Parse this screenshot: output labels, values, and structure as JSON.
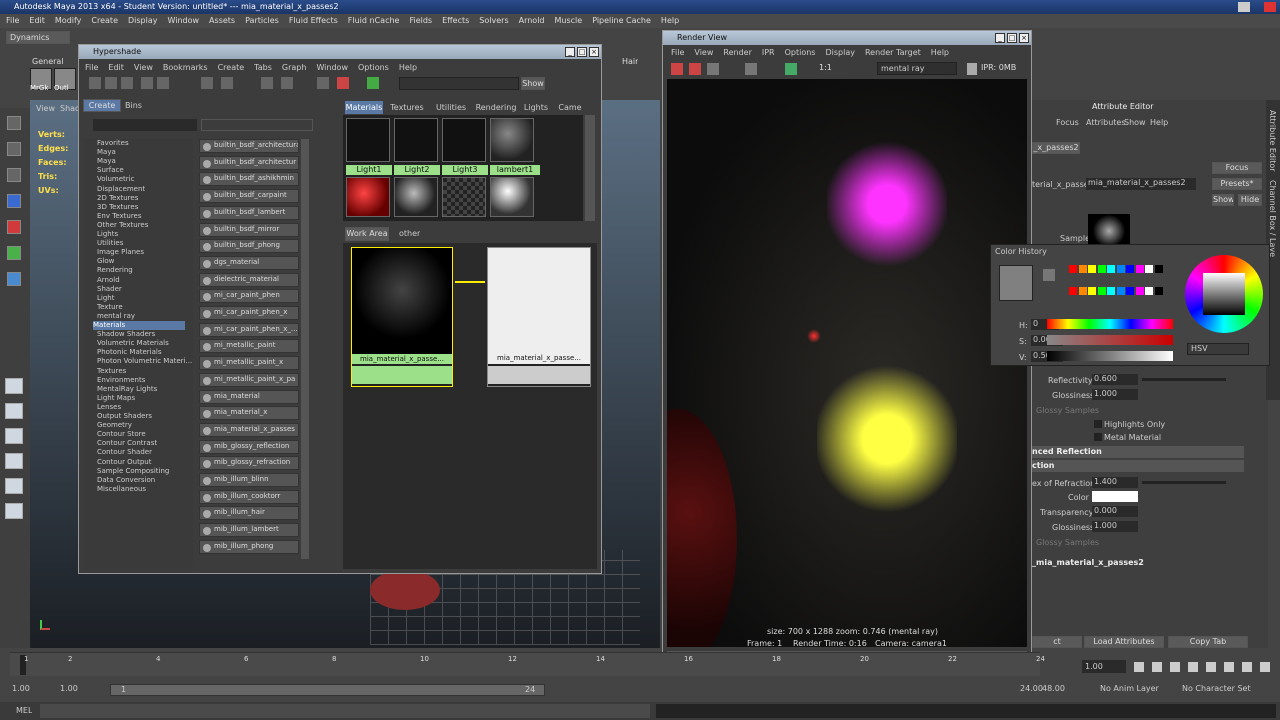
{
  "app": {
    "title": "Autodesk Maya 2013 x64 - Student Version: untitled*  ---  mia_material_x_passes2",
    "menus": [
      "File",
      "Edit",
      "Modify",
      "Create",
      "Display",
      "Window",
      "Assets",
      "Particles",
      "Fluid Effects",
      "Fluid nCache",
      "Fields",
      "Effects",
      "Solvers",
      "Arnold",
      "Muscle",
      "Pipeline Cache",
      "Help"
    ],
    "mode": "Dynamics",
    "shelf_tabs": [
      "General",
      "Hair"
    ],
    "shelf_labels": [
      "MrGk",
      "Outl"
    ]
  },
  "left_panel": {
    "menus": [
      "View",
      "Shad"
    ],
    "hud": [
      "Verts:",
      "Edges:",
      "Faces:",
      "Tris:",
      "UVs:"
    ]
  },
  "hypershade": {
    "title": "Hypershade",
    "menus": [
      "File",
      "Edit",
      "View",
      "Bookmarks",
      "Create",
      "Tabs",
      "Graph",
      "Window",
      "Options",
      "Help"
    ],
    "show": "Show",
    "tabs": [
      "Create",
      "Bins"
    ],
    "tree": [
      "Favorites",
      "Maya",
      "Maya",
      "Surface",
      "Volumetric",
      "Displacement",
      "2D Textures",
      "3D Textures",
      "Env Textures",
      "Other Textures",
      "Lights",
      "Utilities",
      "Image Planes",
      "Glow",
      "Rendering",
      "Arnold",
      "Shader",
      "Light",
      "Texture",
      "mental ray",
      "Materials",
      "Shadow Shaders",
      "Volumetric Materials",
      "Photonic Materials",
      "Photon Volumetric Materi...",
      "Textures",
      "Environments",
      "MentalRay Lights",
      "Light Maps",
      "Lenses",
      "Output Shaders",
      "Geometry",
      "Contour Store",
      "Contour Contrast",
      "Contour Shader",
      "Contour Output",
      "Sample Compositing",
      "Data Conversion",
      "Miscellaneous"
    ],
    "nodes": [
      "builtin_bsdf_architectural",
      "builtin_bsdf_architectur",
      "builtin_bsdf_ashikhmin",
      "builtin_bsdf_carpaint",
      "builtin_bsdf_lambert",
      "builtin_bsdf_mirror",
      "builtin_bsdf_phong",
      "dgs_material",
      "dielectric_material",
      "mi_car_paint_phen",
      "mi_car_paint_phen_x",
      "mi_car_paint_phen_x_...",
      "mi_metallic_paint",
      "mi_metallic_paint_x",
      "mi_metallic_paint_x_pa",
      "mia_material",
      "mia_material_x",
      "mia_material_x_passes",
      "mib_glossy_reflection",
      "mib_glossy_refraction",
      "mib_illum_blinn",
      "mib_illum_cooktorr",
      "mib_illum_hair",
      "mib_illum_lambert",
      "mib_illum_phong"
    ],
    "mat_tabs": [
      "Materials",
      "Textures",
      "Utilities",
      "Rendering",
      "Lights",
      "Came"
    ],
    "swatches": [
      "Light1",
      "Light2",
      "Light3",
      "lambert1"
    ],
    "work_tabs": [
      "Work Area",
      "other"
    ],
    "work_nodes": [
      "mia_material_x_passe...",
      "mia_material_x_passe..."
    ]
  },
  "render_view": {
    "title": "Render View",
    "menus": [
      "File",
      "View",
      "Render",
      "IPR",
      "Options",
      "Display",
      "Render Target",
      "Help"
    ],
    "ratio": "1:1",
    "camera_field": "mental ray",
    "ipr": "IPR: 0MB",
    "status1": "size: 700 x 1288 zoom: 0.746      (mental ray)",
    "frame": "Frame: 1",
    "render_time": "Render Time: 0:16",
    "camera": "Camera: camera1"
  },
  "attr_editor": {
    "title": "Attribute Editor",
    "menus": [
      "Focus",
      "Attributes",
      "Show",
      "Help"
    ],
    "node_tab": "_x_passes2",
    "type_label": "terial_x_passes:",
    "type_value": "mia_material_x_passes2",
    "buttons": [
      "Focus",
      "Presets*",
      "Show",
      "Hide"
    ],
    "sample": "Sample",
    "reflectivity_label": "Reflectivity",
    "reflectivity": "0.600",
    "glossiness_label": "Glossiness",
    "glossiness": "1.000",
    "glossy_samples": "Glossy Samples",
    "highlights_only": "Highlights Only",
    "metal_material": "Metal Material",
    "section1": "nced Reflection",
    "section2": "ction",
    "ior_label": "ex of Refraction",
    "ior": "1.400",
    "color_label": "Color",
    "transparency_label": "Transparency",
    "transparency": "0.000",
    "glossiness2_label": "Glossiness",
    "glossiness2": "1.000",
    "glossy_samples2": "Glossy Samples",
    "footer_node": "_mia_material_x_passes2",
    "bottom_buttons": [
      "ct",
      "Load Attributes",
      "Copy Tab"
    ],
    "side_tabs": [
      "Attribute Editor",
      "Channel Box / Laye"
    ]
  },
  "color_picker": {
    "history_label": "Color History",
    "h_label": "H:",
    "h": "0",
    "s_label": "S:",
    "s": "0.000",
    "v_label": "V:",
    "v": "0.500",
    "mode": "HSV",
    "colors": [
      "#ff0000",
      "#ff8800",
      "#ffff00",
      "#00ff00",
      "#00ffff",
      "#0088ff",
      "#0000ff",
      "#ff00ff",
      "#ffffff",
      "#000000"
    ]
  },
  "timeline": {
    "ticks": [
      "1",
      "2",
      "4",
      "6",
      "8",
      "10",
      "12",
      "14",
      "16",
      "18",
      "20",
      "22",
      "24"
    ],
    "frame": "1.00"
  },
  "range": {
    "start": "1.00",
    "start2": "1.00",
    "cur": "1",
    "end_marker": "24",
    "end": "24.00",
    "end2": "48.00",
    "anim_layer": "No Anim Layer",
    "char_set": "No Character Set"
  },
  "cmd": {
    "label": "MEL"
  }
}
